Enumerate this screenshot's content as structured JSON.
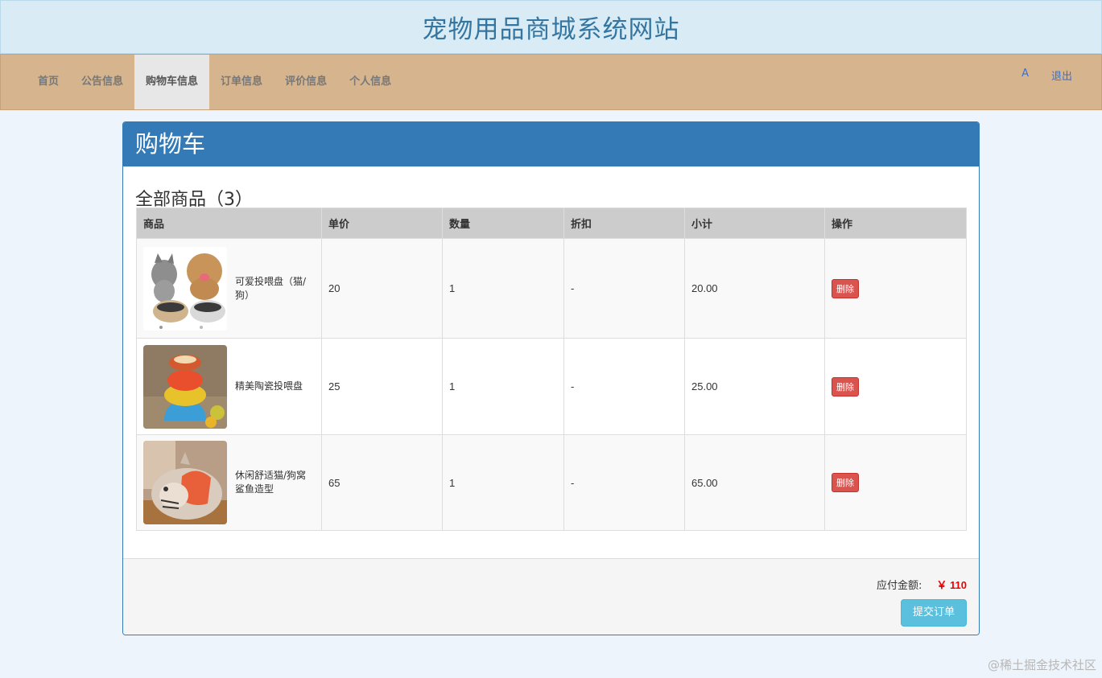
{
  "header": {
    "title": "宠物用品商城系统网站"
  },
  "nav": {
    "items": [
      {
        "label": "首页"
      },
      {
        "label": "公告信息"
      },
      {
        "label": "购物车信息",
        "active": true
      },
      {
        "label": "订单信息"
      },
      {
        "label": "评价信息"
      },
      {
        "label": "个人信息"
      }
    ],
    "user": "A",
    "logout": "退出"
  },
  "panel": {
    "heading": "购物车",
    "section_title": "全部商品（3）"
  },
  "table": {
    "columns": [
      "商品",
      "单价",
      "数量",
      "折扣",
      "小计",
      "操作"
    ],
    "rows": [
      {
        "image": "cat-dog-feeder",
        "name": "可爱投喂盘（猫/狗）",
        "price": "20",
        "qty": "1",
        "discount": "-",
        "subtotal": "20.00",
        "action": "删除"
      },
      {
        "image": "ceramic-feeder",
        "name": "精美陶瓷投喂盘",
        "price": "25",
        "qty": "1",
        "discount": "-",
        "subtotal": "25.00",
        "action": "删除"
      },
      {
        "image": "shark-pet-bed",
        "name": "休闲舒适猫/狗窝鲨鱼造型",
        "price": "65",
        "qty": "1",
        "discount": "-",
        "subtotal": "65.00",
        "action": "删除"
      }
    ]
  },
  "footer": {
    "total_label": "应付金额:",
    "total_value": "￥ 110",
    "submit_label": "提交订单"
  },
  "watermark": "@稀土掘金技术社区",
  "colors": {
    "primary": "#337ab7",
    "nav_bg": "#d6b58e",
    "danger": "#d9534f",
    "info": "#5bc0de",
    "price": "#ee0000"
  }
}
